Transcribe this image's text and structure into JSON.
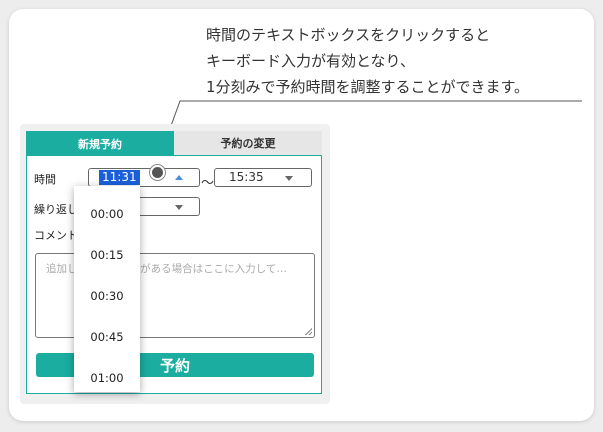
{
  "annotation": {
    "lines": [
      "時間のテキストボックスをクリックすると",
      "キーボード入力が有効となり、",
      "1分刻みで予約時間を調整することができます。"
    ]
  },
  "tabs": {
    "new": "新規予約",
    "change": "予約の変更"
  },
  "form": {
    "time_label": "時間",
    "start_time": "11:31",
    "separator": "～",
    "end_time": "15:35",
    "repeat_label": "繰り返し",
    "comment_label": "コメント",
    "comment_placeholder": "追加して欲しい情報がある場合はここに入力して…",
    "submit_label": "予約"
  },
  "dropdown": {
    "options": [
      "00:00",
      "00:15",
      "00:30",
      "00:45",
      "01:00"
    ]
  },
  "colors": {
    "accent": "#1aada0",
    "selection": "#1b5fd8"
  }
}
